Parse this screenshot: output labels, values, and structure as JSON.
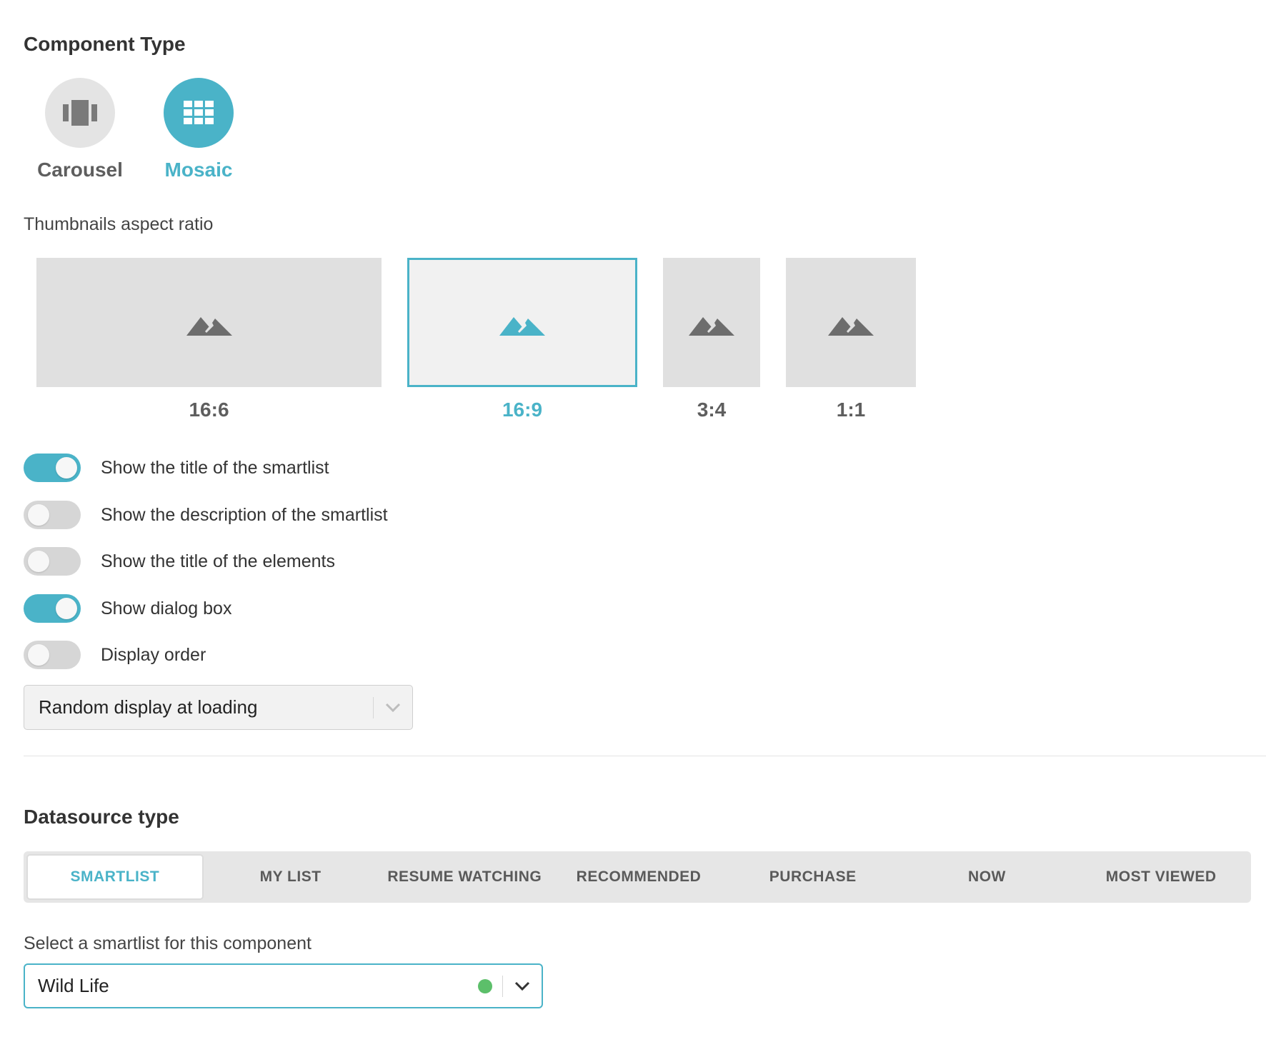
{
  "component_type": {
    "title": "Component Type",
    "options": [
      {
        "label": "Carousel",
        "icon": "carousel-icon",
        "selected": false
      },
      {
        "label": "Mosaic",
        "icon": "grid-icon",
        "selected": true
      }
    ]
  },
  "aspect_ratio": {
    "label": "Thumbnails aspect ratio",
    "options": [
      {
        "label": "16:6",
        "icon": "image-placeholder-icon",
        "selected": false
      },
      {
        "label": "16:9",
        "icon": "image-placeholder-icon",
        "selected": true
      },
      {
        "label": "3:4",
        "icon": "image-placeholder-icon",
        "selected": false
      },
      {
        "label": "1:1",
        "icon": "image-placeholder-icon",
        "selected": false
      }
    ]
  },
  "toggles": [
    {
      "label": "Show the title of the smartlist",
      "on": true
    },
    {
      "label": "Show the description of the smartlist",
      "on": false
    },
    {
      "label": "Show the title of the elements",
      "on": false
    },
    {
      "label": "Show dialog box",
      "on": true
    },
    {
      "label": "Display order",
      "on": false
    }
  ],
  "display_order_select": {
    "value": "Random display at loading"
  },
  "datasource": {
    "title": "Datasource type",
    "tabs": [
      "SMARTLIST",
      "MY LIST",
      "RESUME WATCHING",
      "RECOMMENDED",
      "PURCHASE",
      "NOW",
      "MOST VIEWED"
    ],
    "active_tab": "SMARTLIST"
  },
  "smartlist_select": {
    "label": "Select a smartlist for this component",
    "value": "Wild Life",
    "status": "active"
  },
  "colors": {
    "accent": "#4ab3c8",
    "inactive_text": "#5e5e5e",
    "status_green": "#5cbf6a"
  }
}
